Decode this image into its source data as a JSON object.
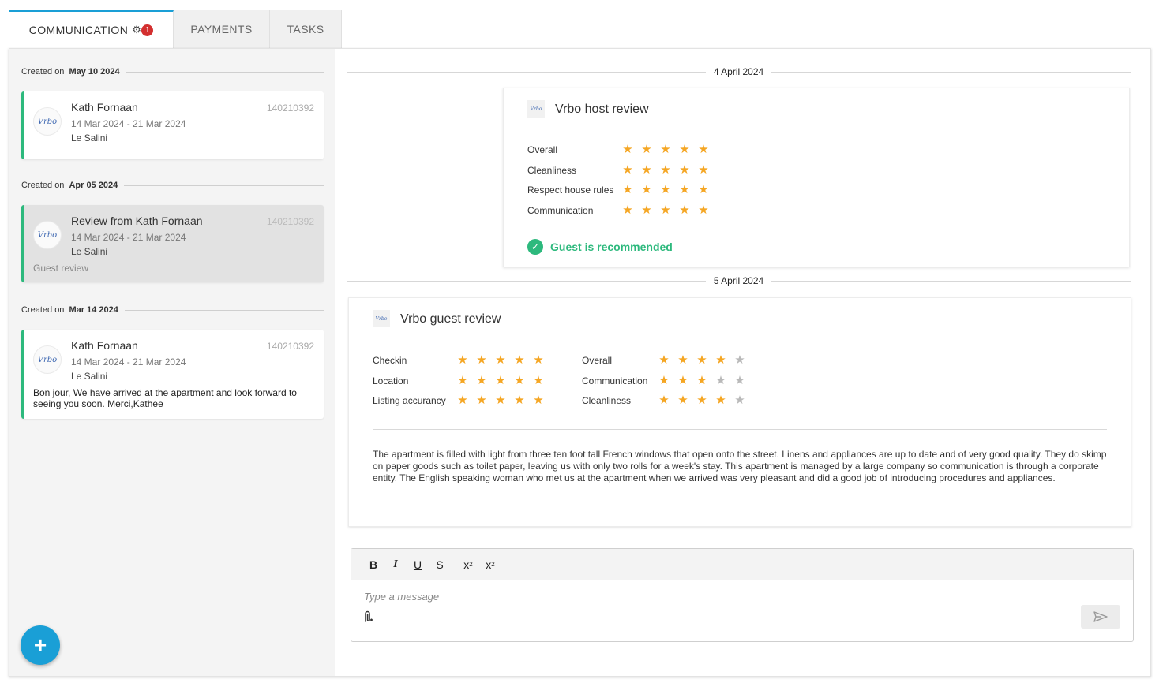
{
  "tabs": {
    "communication": "COMMUNICATION",
    "communication_badge": "1",
    "payments": "PAYMENTS",
    "tasks": "TASKS"
  },
  "conversations": [
    {
      "created_label": "Created on",
      "created_date": "May 10 2024",
      "logo_text": "Vrbo",
      "name": "Kath Fornaan",
      "reservation_id": "140210392",
      "dates": "14 Mar 2024 - 21 Mar 2024",
      "property": "Le Salini"
    },
    {
      "created_label": "Created on",
      "created_date": "Apr 05 2024",
      "logo_text": "Vrbo",
      "name": "Review from Kath Fornaan",
      "reservation_id": "140210392",
      "dates": "14 Mar 2024 - 21 Mar 2024",
      "property": "Le Salini",
      "type": "Guest review"
    },
    {
      "created_label": "Created on",
      "created_date": "Mar 14 2024",
      "logo_text": "Vrbo",
      "name": "Kath Fornaan",
      "reservation_id": "140210392",
      "dates": "14 Mar 2024 - 21 Mar 2024",
      "property": "Le Salini",
      "message": "Bon jour, We have arrived at the apartment and look forward to seeing you soon. Merci,Kathee"
    }
  ],
  "thread": {
    "date1": "4 April 2024",
    "host_review": {
      "logo_text": "Vrbo",
      "title": "Vrbo host review",
      "ratings": [
        {
          "label": "Overall",
          "stars": 5
        },
        {
          "label": "Cleanliness",
          "stars": 5
        },
        {
          "label": "Respect house rules",
          "stars": 5
        },
        {
          "label": "Communication",
          "stars": 5
        }
      ],
      "recommended": "Guest is recommended"
    },
    "date2": "5 April 2024",
    "guest_review": {
      "logo_text": "Vrbo",
      "title": "Vrbo guest review",
      "ratings_left": [
        {
          "label": "Checkin",
          "stars": 5
        },
        {
          "label": "Location",
          "stars": 5
        },
        {
          "label": "Listing accurancy",
          "stars": 5
        }
      ],
      "ratings_right": [
        {
          "label": "Overall",
          "stars": 4
        },
        {
          "label": "Communication",
          "stars": 3
        },
        {
          "label": "Cleanliness",
          "stars": 4
        }
      ],
      "text": "The apartment is filled with light from three ten foot tall French windows that open onto the street. Linens and appliances are up to date and of very good quality. They do skimp on paper goods such as toilet paper, leaving us with only two rolls for a week's stay. This apartment is managed by a large company so communication is through a corporate entity. The English speaking woman who met us at the apartment when we arrived was very pleasant and did a good job of introducing procedures and appliances."
    }
  },
  "editor": {
    "placeholder": "Type a message",
    "bold": "B",
    "italic": "I",
    "underline": "U",
    "strike": "S",
    "subscript_base": "x",
    "subscript": "2",
    "superscript_base": "x",
    "superscript": "2"
  },
  "colors": {
    "accent": "#1a9fd6",
    "green": "#2db97d",
    "star": "#f5a623",
    "star_off": "#b9b9b9",
    "badge": "#d32f2f"
  }
}
